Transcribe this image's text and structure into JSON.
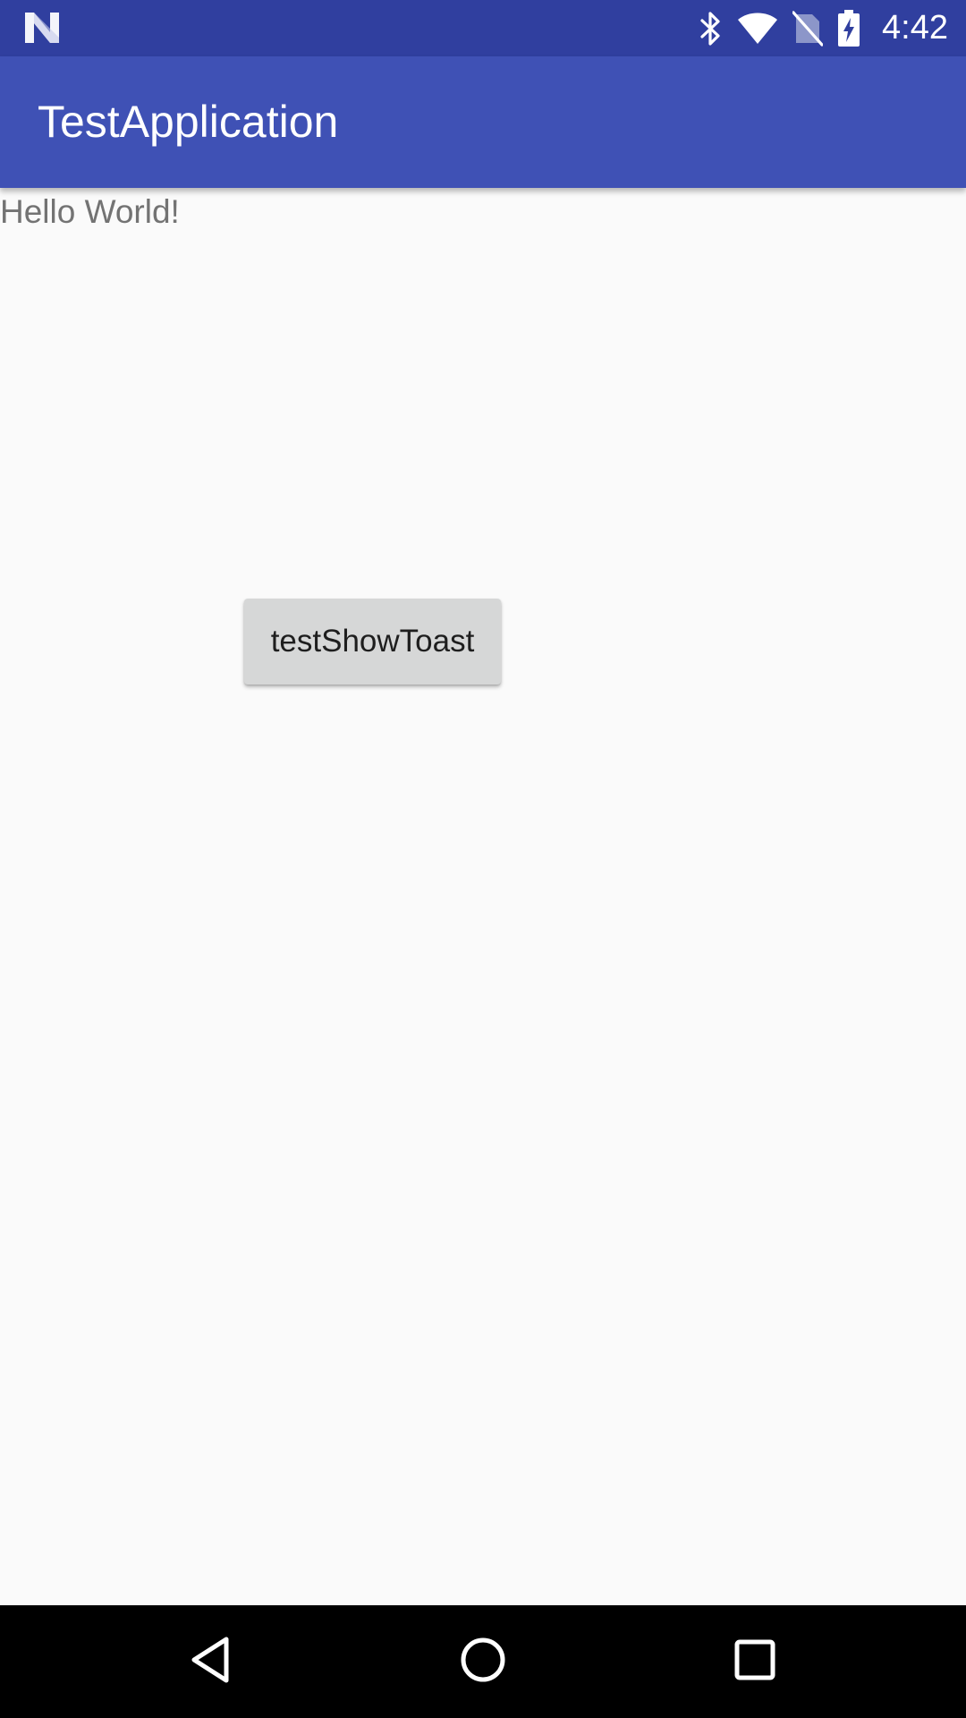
{
  "status_bar": {
    "time": "4:42",
    "background": "#303f9f",
    "icons": [
      "notification-n-icon",
      "bluetooth-icon",
      "wifi-icon",
      "no-sim-icon",
      "battery-charging-icon"
    ]
  },
  "app_bar": {
    "title": "TestApplication",
    "background": "#3f51b5"
  },
  "main": {
    "hello_text": "Hello World!",
    "toast_button_label": "testShowToast"
  },
  "nav_bar": {
    "buttons": [
      "back-icon",
      "home-icon",
      "recents-icon"
    ]
  }
}
